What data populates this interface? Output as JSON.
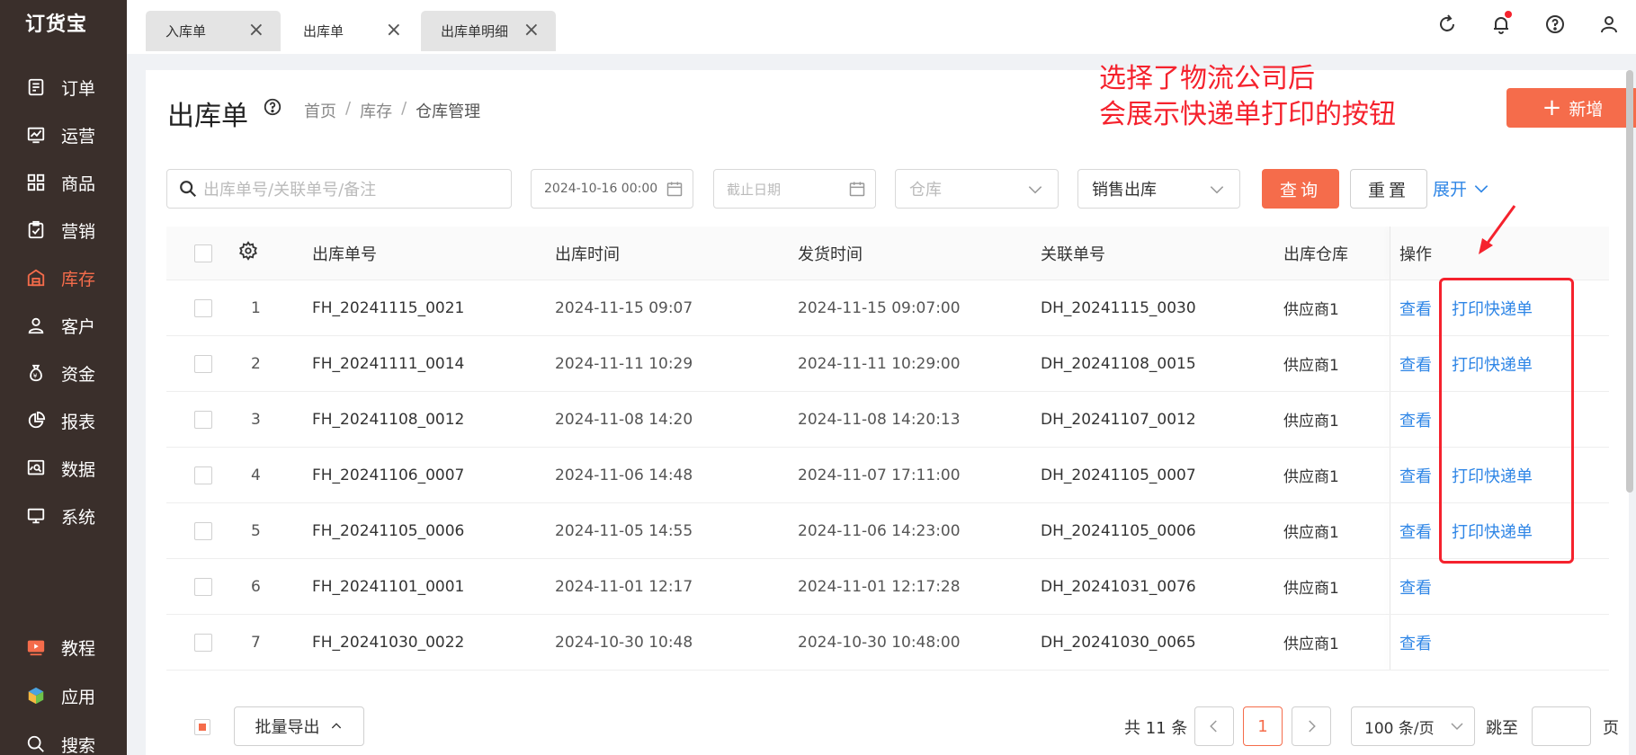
{
  "app": {
    "logo": "订货宝"
  },
  "sidebar": {
    "items": [
      {
        "label": "订单",
        "icon": "order-icon"
      },
      {
        "label": "运营",
        "icon": "operation-chart-icon"
      },
      {
        "label": "商品",
        "icon": "grid-icon"
      },
      {
        "label": "营销",
        "icon": "clipboard-check-icon"
      },
      {
        "label": "库存",
        "icon": "warehouse-icon",
        "active": true
      },
      {
        "label": "客户",
        "icon": "user-icon"
      },
      {
        "label": "资金",
        "icon": "money-bag-icon"
      },
      {
        "label": "报表",
        "icon": "pie-chart-icon"
      },
      {
        "label": "数据",
        "icon": "data-search-icon"
      },
      {
        "label": "系统",
        "icon": "monitor-icon"
      }
    ],
    "bottom": [
      {
        "label": "教程",
        "icon": "video-icon"
      },
      {
        "label": "应用",
        "icon": "cube-icon"
      },
      {
        "label": "搜索",
        "icon": "search-icon"
      }
    ]
  },
  "tabs": [
    {
      "label": "入库单",
      "active": false
    },
    {
      "label": "出库单",
      "active": true
    },
    {
      "label": "出库单明细",
      "active": false
    }
  ],
  "page": {
    "title": "出库单",
    "breadcrumb": [
      "首页",
      "库存",
      "仓库管理"
    ],
    "add_label": "新增",
    "annotation_line1": "选择了物流公司后",
    "annotation_line2": "会展示快递单打印的按钮"
  },
  "filters": {
    "search_placeholder": "出库单号/关联单号/备注",
    "date_start": "2024-10-16 00:00",
    "date_end_placeholder": "截止日期",
    "warehouse_placeholder": "仓库",
    "type_value": "销售出库",
    "query_label": "查询",
    "reset_label": "重置",
    "expand_label": "展开"
  },
  "table": {
    "headers": {
      "no": "出库单号",
      "out_time": "出库时间",
      "ship_time": "发货时间",
      "rel_no": "关联单号",
      "warehouse": "出库仓库",
      "ops": "操作"
    },
    "view_label": "查看",
    "print_label": "打印快递单",
    "rows": [
      {
        "idx": "1",
        "no": "FH_20241115_0021",
        "out_time": "2024-11-15 09:07",
        "ship_time": "2024-11-15 09:07:00",
        "rel_no": "DH_20241115_0030",
        "warehouse": "供应商1",
        "print": true
      },
      {
        "idx": "2",
        "no": "FH_20241111_0014",
        "out_time": "2024-11-11 10:29",
        "ship_time": "2024-11-11 10:29:00",
        "rel_no": "DH_20241108_0015",
        "warehouse": "供应商1",
        "print": true
      },
      {
        "idx": "3",
        "no": "FH_20241108_0012",
        "out_time": "2024-11-08 14:20",
        "ship_time": "2024-11-08 14:20:13",
        "rel_no": "DH_20241107_0012",
        "warehouse": "供应商1",
        "print": false
      },
      {
        "idx": "4",
        "no": "FH_20241106_0007",
        "out_time": "2024-11-06 14:48",
        "ship_time": "2024-11-07 17:11:00",
        "rel_no": "DH_20241105_0007",
        "warehouse": "供应商1",
        "print": true
      },
      {
        "idx": "5",
        "no": "FH_20241105_0006",
        "out_time": "2024-11-05 14:55",
        "ship_time": "2024-11-06 14:23:00",
        "rel_no": "DH_20241105_0006",
        "warehouse": "供应商1",
        "print": true
      },
      {
        "idx": "6",
        "no": "FH_20241101_0001",
        "out_time": "2024-11-01 12:17",
        "ship_time": "2024-11-01 12:17:28",
        "rel_no": "DH_20241031_0076",
        "warehouse": "供应商1",
        "print": false
      },
      {
        "idx": "7",
        "no": "FH_20241030_0022",
        "out_time": "2024-10-30 10:48",
        "ship_time": "2024-10-30 10:48:00",
        "rel_no": "DH_20241030_0065",
        "warehouse": "供应商1",
        "print": false
      }
    ]
  },
  "footer": {
    "batch_export": "批量导出",
    "total": "共 11 条",
    "current_page": "1",
    "page_size": "100 条/页",
    "jump_label": "跳至",
    "page_suffix": "页"
  },
  "colors": {
    "accent": "#f56c4b",
    "link": "#2f86e6",
    "annotation": "#f5222d",
    "sidebar": "#3a2f2b"
  }
}
